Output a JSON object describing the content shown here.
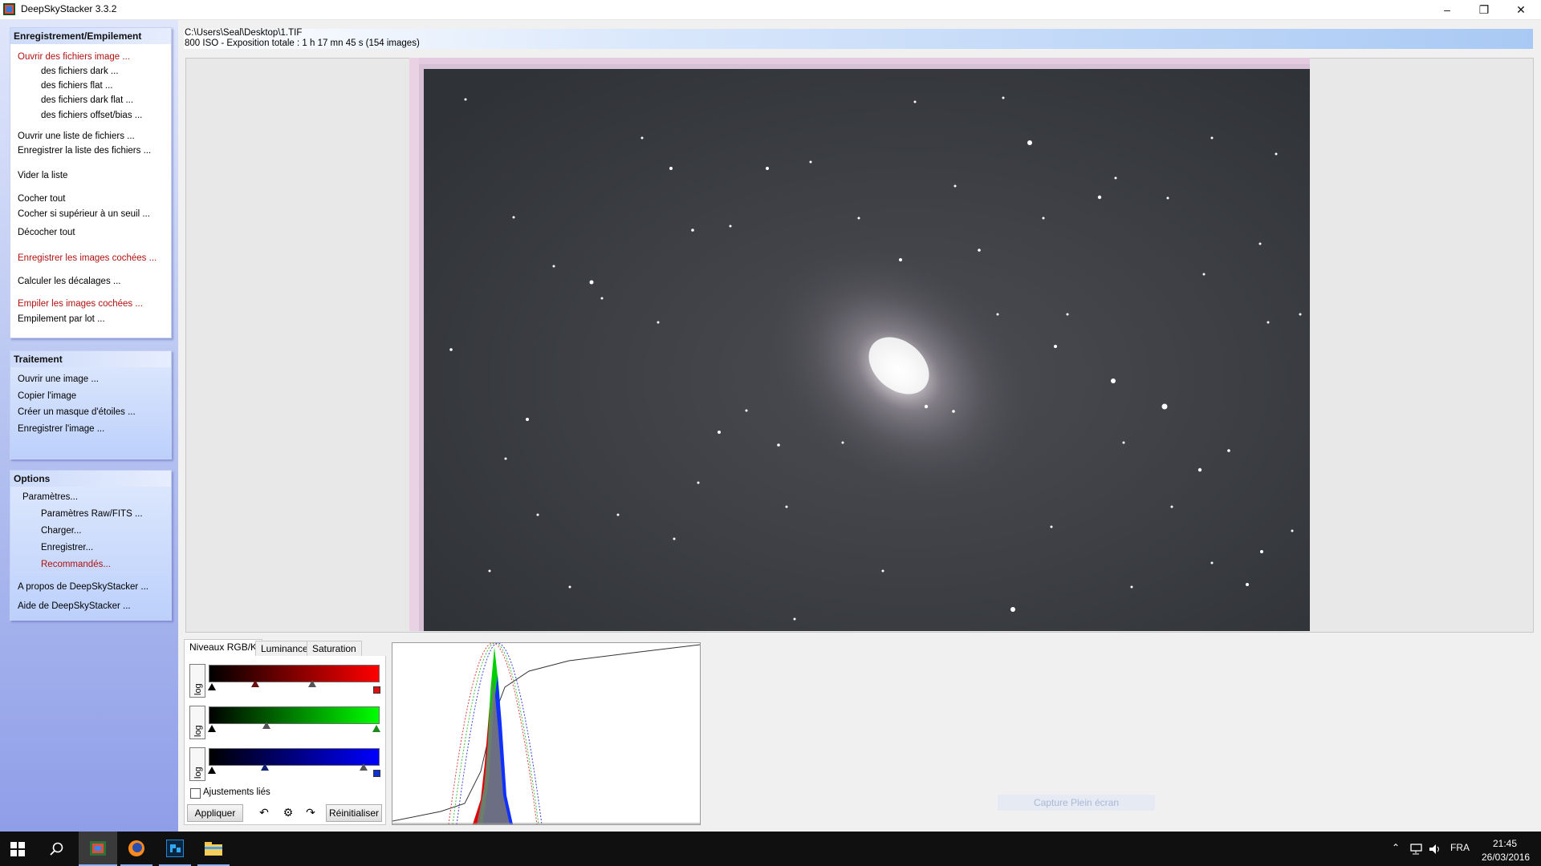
{
  "window": {
    "title": "DeepSkyStacker 3.3.2"
  },
  "sidebar": {
    "registering": {
      "header": "Enregistrement/Empilement",
      "items": [
        "Ouvrir des fichiers image ...",
        "des fichiers dark ...",
        "des fichiers flat ...",
        "des fichiers dark flat ...",
        "des fichiers offset/bias ...",
        "Ouvrir une liste de fichiers ...",
        "Enregistrer la liste des fichiers ...",
        "Vider la liste",
        "Cocher tout",
        "Cocher si supérieur à un seuil ...",
        "Décocher tout",
        "Enregistrer les images cochées ...",
        "Calculer les décalages ...",
        "Empiler les images cochées ...",
        "Empilement par lot ..."
      ]
    },
    "processing": {
      "header": "Traitement",
      "items": [
        "Ouvrir une image ...",
        "Copier l'image",
        "Créer un masque d'étoiles ...",
        "Enregistrer l'image ..."
      ]
    },
    "options": {
      "header": "Options",
      "items": [
        "Paramètres...",
        "Paramètres Raw/FITS ...",
        "Charger...",
        "Enregistrer...",
        "Recommandés...",
        "A propos de DeepSkyStacker ...",
        "Aide de DeepSkyStacker ..."
      ]
    }
  },
  "main": {
    "path": "C:\\Users\\Seal\\Desktop\\1.TIF",
    "info": "800 ISO - Exposition totale : 1 h 17 mn 45 s (154 images)"
  },
  "levels": {
    "tabs": [
      "Niveaux RGB/K",
      "Luminance",
      "Saturation"
    ],
    "log_label": "log",
    "linked_label": "Ajustements liés",
    "linked_checked": false,
    "apply_label": "Appliquer",
    "reset_label": "Réinitialiser",
    "channels": [
      {
        "name": "red",
        "color": "#ff0000"
      },
      {
        "name": "green",
        "color": "#00ff00"
      },
      {
        "name": "blue",
        "color": "#0000ff"
      }
    ]
  },
  "capture_label": "Capture Plein écran",
  "taskbar": {
    "language": "FRA",
    "time": "21:45",
    "date": "26/03/2016"
  },
  "colors": {
    "accent": "#1f5fe0",
    "link_red": "#b01010"
  }
}
